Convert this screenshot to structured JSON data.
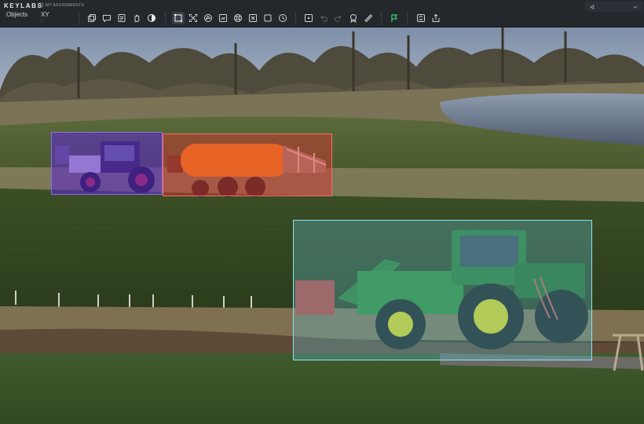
{
  "app": {
    "brand": "KEYLABS",
    "assignments_label": "MY ASSIGNMENTS"
  },
  "left_tabs": {
    "objects": "Objects",
    "xy": "XY",
    "xy_sub": "-"
  },
  "toolbar_tools": [
    {
      "name": "copy-objects-icon",
      "label": "copy"
    },
    {
      "name": "comment-icon",
      "label": "comment"
    },
    {
      "name": "notes-icon",
      "label": "notes"
    },
    {
      "name": "hand-pan-icon",
      "label": "pan"
    },
    {
      "name": "contrast-icon",
      "label": "contrast"
    },
    {
      "name": "bbox-tool-icon",
      "label": "bounding box",
      "active": true
    },
    {
      "name": "expand-icon",
      "label": "expand"
    },
    {
      "name": "polygon-icon",
      "label": "polygon"
    },
    {
      "name": "segmentation-icon",
      "label": "segmentation"
    },
    {
      "name": "grid-mask-icon",
      "label": "grid mask"
    },
    {
      "name": "layers-icon",
      "label": "layers"
    },
    {
      "name": "square-icon",
      "label": "square"
    },
    {
      "name": "history-icon",
      "label": "history"
    },
    {
      "name": "add-point-icon",
      "label": "add point"
    },
    {
      "name": "undo-icon",
      "label": "undo"
    },
    {
      "name": "redo-icon",
      "label": "redo"
    },
    {
      "name": "badge-icon",
      "label": "badge"
    },
    {
      "name": "ruler-icon",
      "label": "ruler"
    },
    {
      "name": "flag-icon",
      "label": "flag",
      "color": "#35d06b"
    },
    {
      "name": "sync-icon",
      "label": "sync"
    },
    {
      "name": "share-icon",
      "label": "share"
    }
  ],
  "annotations": [
    {
      "object": "tractor-small",
      "color": "#5c26d2"
    },
    {
      "object": "tank-trailer",
      "color": "#de3430"
    },
    {
      "object": "tractor-large",
      "color": "#64bed2"
    }
  ],
  "colors": {
    "toolbar_bg": "#24272c",
    "accent_green": "#35d06b",
    "purple_box": "#5c26d2",
    "red_box": "#de3430",
    "cyan_box": "#64bed2"
  }
}
